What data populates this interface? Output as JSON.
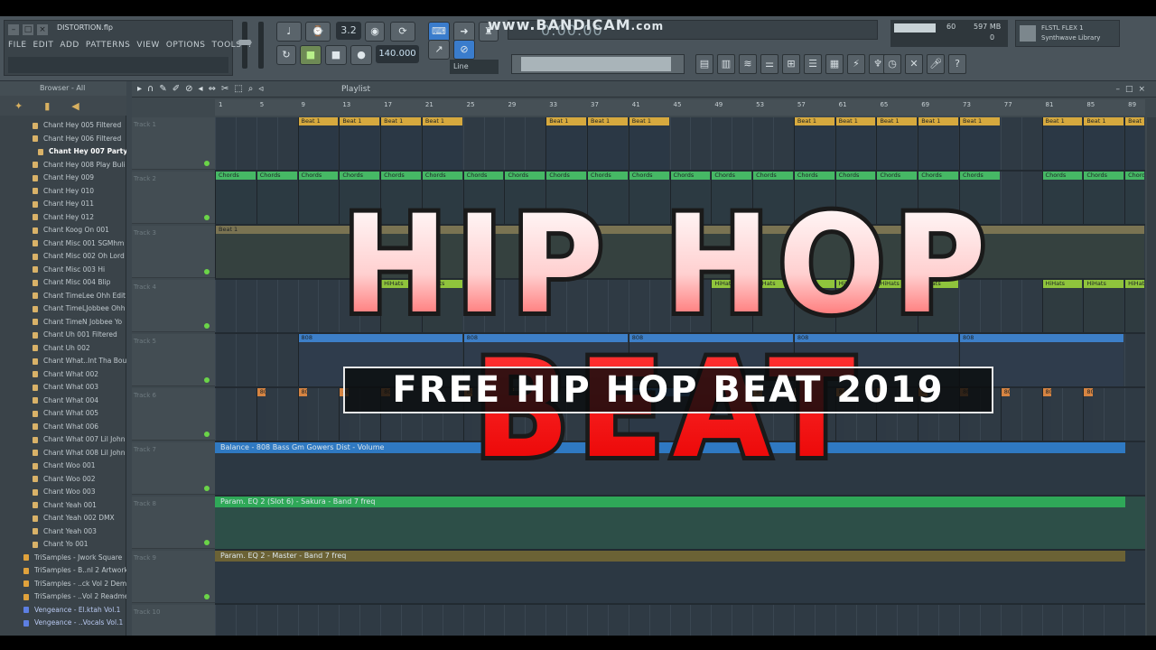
{
  "window": {
    "file_name": "DISTORTION.flp",
    "menu": [
      "FILE",
      "EDIT",
      "ADD",
      "PATTERNS",
      "VIEW",
      "OPTIONS",
      "TOOLS",
      "?"
    ]
  },
  "toolbar": {
    "pattern_number": "3.2",
    "tempo": "140.000",
    "time": "0:00:00",
    "snap": "Line",
    "cpu_value": "60",
    "memory": "597 MB",
    "memory_sub": "0",
    "plugin_line1": "FLSTL FLEX 1",
    "plugin_line2": "Synthwave Library"
  },
  "watermark": {
    "main": "www.BANDICAM",
    "suffix": ".com"
  },
  "browser": {
    "header": "Browser - All",
    "items": [
      {
        "label": "Chant Hey 005 Filtered",
        "state": "folder"
      },
      {
        "label": "Chant Hey 006 Filtered",
        "state": "folder"
      },
      {
        "label": "Chant Hey 007 Party",
        "state": "open"
      },
      {
        "label": "Chant Hey 008 Play Buli",
        "state": "folder"
      },
      {
        "label": "Chant Hey 009",
        "state": "folder"
      },
      {
        "label": "Chant Hey 010",
        "state": "folder"
      },
      {
        "label": "Chant Hey 011",
        "state": "folder"
      },
      {
        "label": "Chant Hey 012",
        "state": "folder"
      },
      {
        "label": "Chant Koog On 001",
        "state": "folder"
      },
      {
        "label": "Chant Misc 001 SGMhm",
        "state": "folder"
      },
      {
        "label": "Chant Misc 002 Oh Lord",
        "state": "folder"
      },
      {
        "label": "Chant Misc 003 Hi",
        "state": "folder"
      },
      {
        "label": "Chant Misc 004 Blip",
        "state": "folder"
      },
      {
        "label": "Chant TimeLee Ohh Edit",
        "state": "folder"
      },
      {
        "label": "Chant TimeLJobbee Ohh",
        "state": "folder"
      },
      {
        "label": "Chant TimeN Jobbee Yo",
        "state": "folder"
      },
      {
        "label": "Chant Uh 001 Filtered",
        "state": "folder"
      },
      {
        "label": "Chant Uh 002",
        "state": "folder"
      },
      {
        "label": "Chant What..Int Tha Bou",
        "state": "folder"
      },
      {
        "label": "Chant What 002",
        "state": "folder"
      },
      {
        "label": "Chant What 003",
        "state": "folder"
      },
      {
        "label": "Chant What 004",
        "state": "folder"
      },
      {
        "label": "Chant What 005",
        "state": "folder"
      },
      {
        "label": "Chant What 006",
        "state": "folder"
      },
      {
        "label": "Chant What 007 Lil John",
        "state": "folder"
      },
      {
        "label": "Chant What 008 Lil John",
        "state": "folder"
      },
      {
        "label": "Chant Woo 001",
        "state": "folder"
      },
      {
        "label": "Chant Woo 002",
        "state": "folder"
      },
      {
        "label": "Chant Woo 003",
        "state": "folder"
      },
      {
        "label": "Chant Yeah 001",
        "state": "folder"
      },
      {
        "label": "Chant Yeah 002 DMX",
        "state": "folder"
      },
      {
        "label": "Chant Yeah 003",
        "state": "folder"
      },
      {
        "label": "Chant Yo 001",
        "state": "folder"
      },
      {
        "label": "TriSamples - Jwork Square",
        "state": "pack"
      },
      {
        "label": "TriSamples - B..nl 2 Artwork",
        "state": "pack"
      },
      {
        "label": "TriSamples - ..ck Vol 2 Demo",
        "state": "pack"
      },
      {
        "label": "TriSamples - ..Vol 2 Readme",
        "state": "pack"
      },
      {
        "label": "Vengeance - El.ktah Vol.1",
        "state": "blue"
      },
      {
        "label": "Vengeance - ..Vocals Vol.1",
        "state": "blue"
      }
    ]
  },
  "playlist": {
    "title": "Playlist",
    "timeline": [
      "1",
      "5",
      "9",
      "13",
      "17",
      "21",
      "25",
      "29",
      "33",
      "37",
      "41",
      "45",
      "49",
      "53",
      "57",
      "61",
      "65",
      "69",
      "73",
      "77",
      "81",
      "85",
      "89"
    ],
    "tracks": [
      "Track 1",
      "Track 2",
      "Track 3",
      "Track 4",
      "Track 5",
      "Track 6",
      "Track 7",
      "Track 8",
      "Track 9",
      "Track 10"
    ],
    "clip_names": {
      "beat": "Beat 1",
      "chords": "Chords",
      "hihats": "HiHats",
      "bass": "808",
      "bass2": "808 A2"
    },
    "automation": [
      {
        "label": "Balance - 808 Bass Gm Gowers Dist - Volume",
        "color": "#2f79c2"
      },
      {
        "label": "Param. EQ 2 (Slot 6) - Sakura - Band 7 freq",
        "color": "#2fa858"
      },
      {
        "label": "Param. EQ 2 - Master - Band 7 freq",
        "color": "#6b6235"
      }
    ]
  },
  "overlay": {
    "title": "HIP HOP BEAT",
    "subtitle": "FREE HIP HOP BEAT 2019"
  },
  "colors": {
    "beat_clip": "#d6a93e",
    "chords_clip": "#46b865",
    "hihats_clip": "#8fc43c",
    "bass_clip": "#3d7fc8",
    "kick_clip": "#d68442"
  }
}
